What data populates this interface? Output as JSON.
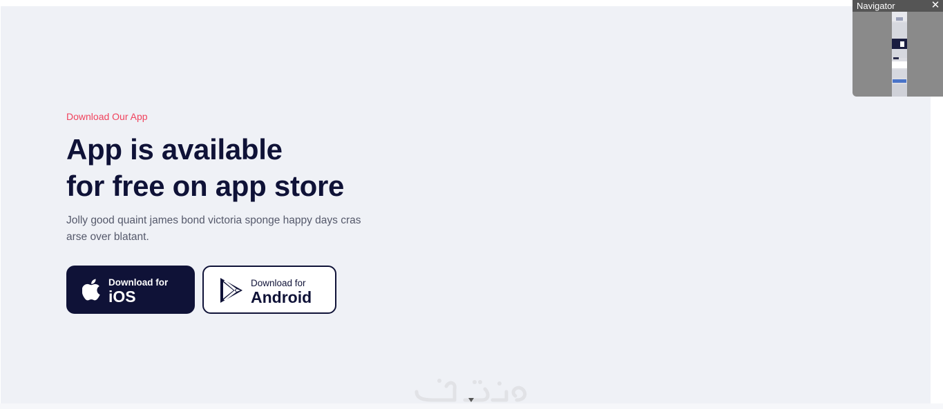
{
  "app_section": {
    "eyebrow": "Download Our App",
    "headline_line1": "App is available",
    "headline_line2": "for free on app store",
    "description": "Jolly good quaint james bond victoria sponge happy days cras arse over blatant."
  },
  "buttons": {
    "ios": {
      "small_label": "Download for",
      "big_label": "iOS",
      "icon": "apple-icon"
    },
    "android": {
      "small_label": "Download for",
      "big_label": "Android",
      "icon": "google-play-icon"
    }
  },
  "navigator": {
    "title": "Navigator",
    "close_icon": "close-icon"
  },
  "colors": {
    "accent": "#f0425c",
    "navy": "#0f1237",
    "section_bg": "#eff1f6",
    "body_text": "#55596b"
  }
}
